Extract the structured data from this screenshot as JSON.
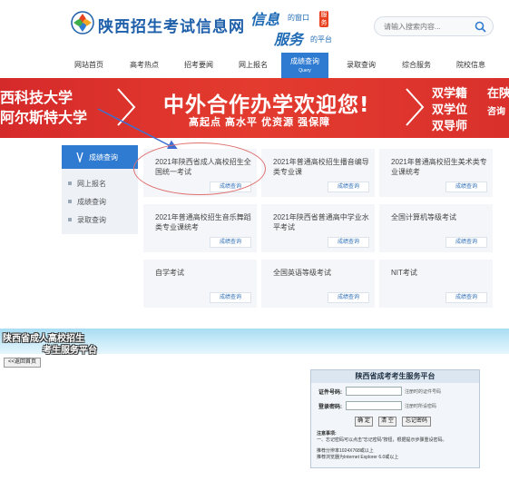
{
  "header": {
    "site_title": "陕西招生考试信息网",
    "slogan_line1_big": "信息",
    "slogan_line1_small": "的窗口",
    "slogan_badge": "服务",
    "slogan_line2_big": "服务",
    "slogan_line2_small": "的平台",
    "search_placeholder": "请输入搜索内容..."
  },
  "nav": {
    "items": [
      "网站首页",
      "高考热点",
      "招考要闻",
      "网上报名",
      "成绩查询",
      "录取查询",
      "综合服务",
      "院校信息"
    ],
    "active_label": "成绩查询",
    "active_sub": "Query"
  },
  "banner": {
    "left_line1": "西科技大学",
    "left_line2": "阿尔斯特大学",
    "headline": "中外合作办学欢迎您!",
    "subline": "高起点  高水平  优资源  强保障",
    "right_lines": [
      "双学籍",
      "双学位",
      "双导师"
    ],
    "edge_lines": [
      "在陕",
      "咨询"
    ]
  },
  "sidebar": {
    "heading": "成绩查询",
    "items": [
      "网上报名",
      "成绩查询",
      "录取查询"
    ]
  },
  "cards": [
    {
      "title": "2021年陕西省成人高校招生全国统一考试",
      "button": "成绩查询"
    },
    {
      "title": "2021年普通高校招生播音编导类专业课",
      "button": "成绩查询"
    },
    {
      "title": "2021年普通高校招生美术类专业课统考",
      "button": "成绩查询"
    },
    {
      "title": "2021年普通高校招生音乐舞蹈类专业课统考",
      "button": "成绩查询"
    },
    {
      "title": "2021年陕西省普通高中学业水平考试",
      "button": "成绩查询"
    },
    {
      "title": "全国计算机等级考试",
      "button": "成绩查询"
    },
    {
      "title": "自学考试",
      "button": "成绩查询"
    },
    {
      "title": "全国英语等级考试",
      "button": "成绩查询"
    },
    {
      "title": "NIT考试",
      "button": "成绩查询"
    }
  ],
  "lower": {
    "strip_line1": "陕西省成人高校招生",
    "strip_line2": "考生服务平台",
    "back_button": "<<返回首页"
  },
  "login": {
    "title": "陕西省成考考生服务平台",
    "id_label": "证件号码:",
    "id_hint": "注册时的证件号码",
    "pwd_label": "登录密码:",
    "pwd_hint": "注册时所设密码",
    "confirm": "确 定",
    "clear": "清 空",
    "forgot": "忘记密码",
    "notes_heading": "注意事项:",
    "note1": "一、忘记密码可以点击\"忘记密码\"按钮，根据提示步骤重设密码。",
    "note2": "推荐分辨率1024X768或以上",
    "note3": "推荐浏览器为Internet Explorer 6.0或以上"
  },
  "colors": {
    "primary_blue": "#2f7bd1",
    "banner_red": "#d9302c",
    "annotation_red": "#e07171"
  }
}
